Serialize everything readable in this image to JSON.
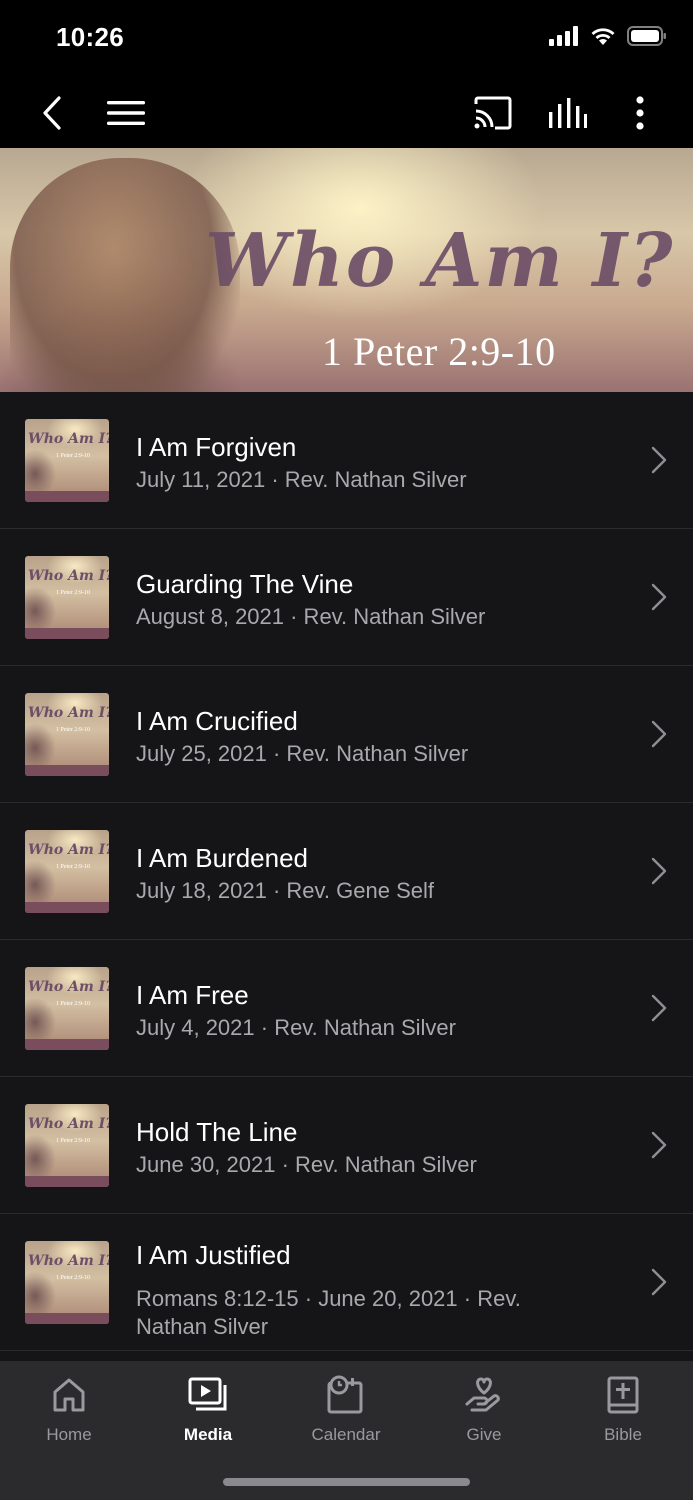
{
  "status_bar": {
    "time": "10:26"
  },
  "hero": {
    "title": "Who Am I?",
    "subtitle": "1 Peter 2:9-10"
  },
  "sermons": [
    {
      "title": "I Am Forgiven",
      "subtitle": "July 11, 2021 · Rev. Nathan Silver"
    },
    {
      "title": "Guarding The Vine",
      "subtitle": "August 8, 2021 · Rev. Nathan Silver"
    },
    {
      "title": "I Am Crucified",
      "subtitle": "July 25, 2021 · Rev. Nathan Silver"
    },
    {
      "title": "I Am Burdened",
      "subtitle": "July 18, 2021 · Rev. Gene Self"
    },
    {
      "title": "I Am Free",
      "subtitle": "July 4, 2021 · Rev. Nathan Silver"
    },
    {
      "title": "Hold The Line",
      "subtitle": "June 30, 2021 · Rev. Nathan Silver"
    },
    {
      "title": "I Am Justified",
      "subtitle": "Romans 8:12-15 · June 20, 2021 · Rev. Nathan Silver"
    }
  ],
  "thumbnail": {
    "title": "Who Am I?",
    "subtitle": "1 Peter 2:9-10"
  },
  "tabs": [
    {
      "label": "Home",
      "icon": "home-icon"
    },
    {
      "label": "Media",
      "icon": "media-icon"
    },
    {
      "label": "Calendar",
      "icon": "calendar-icon"
    },
    {
      "label": "Give",
      "icon": "give-icon"
    },
    {
      "label": "Bible",
      "icon": "bible-icon"
    }
  ],
  "active_tab": "Media",
  "colors": {
    "background": "#151517",
    "bar": "#000000",
    "tab_bar": "#2b2b2e",
    "secondary_text": "#a9a9ad"
  }
}
